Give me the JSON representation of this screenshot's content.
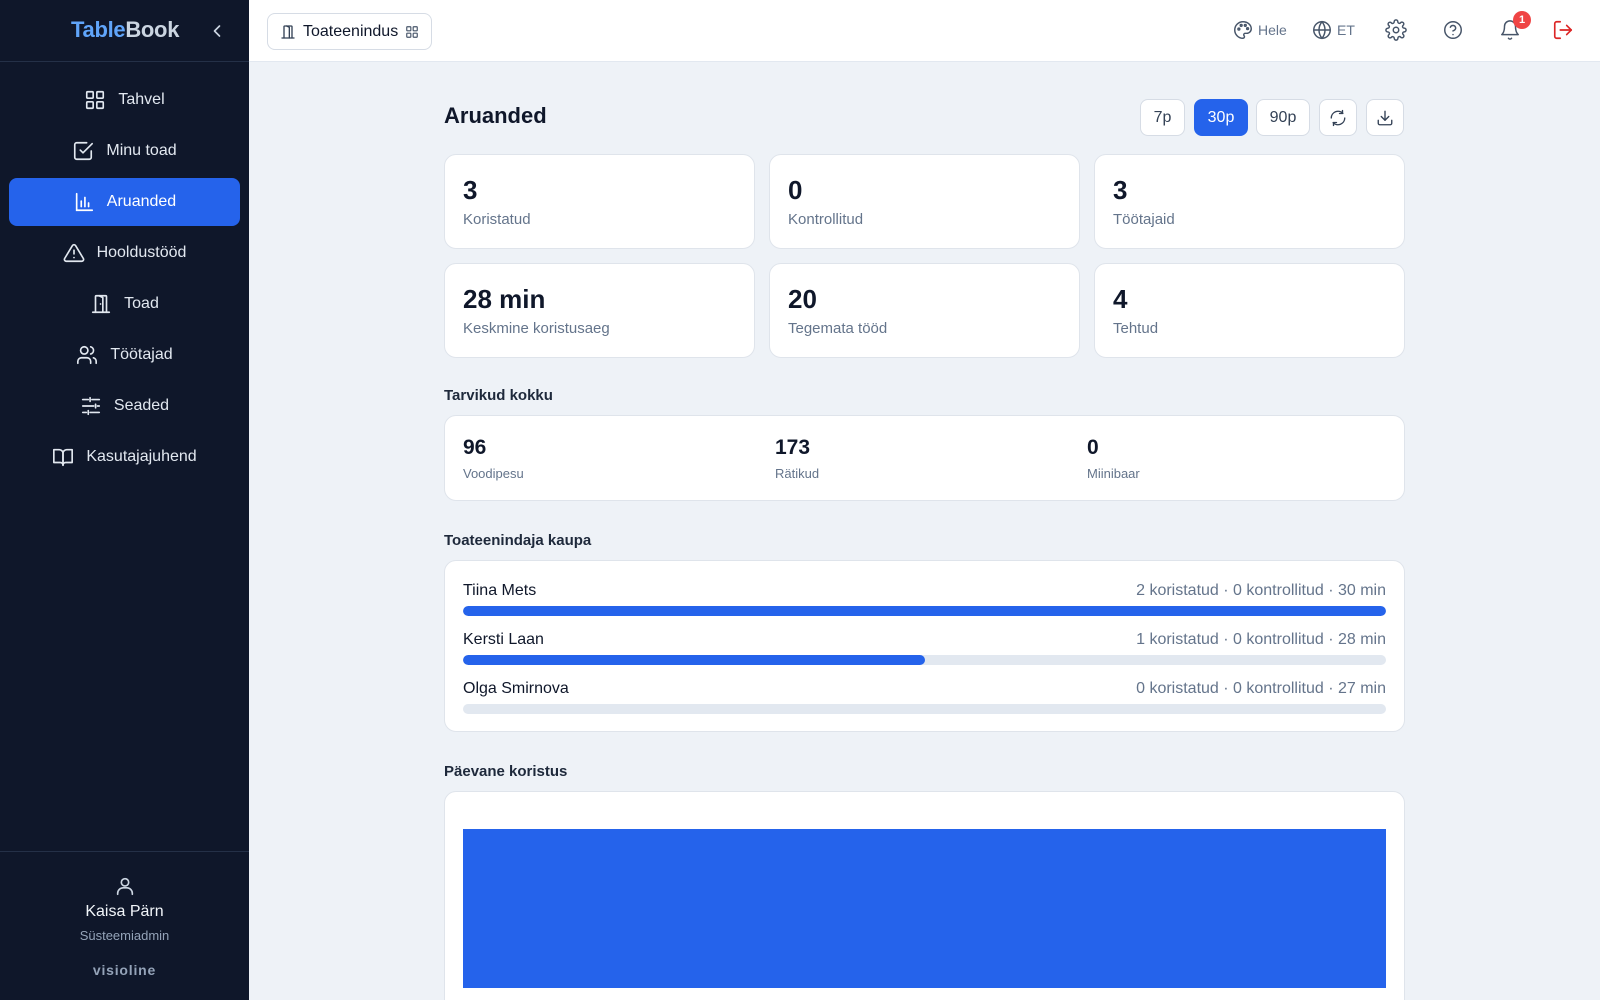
{
  "brand": {
    "part1": "Table",
    "part2": "Book"
  },
  "sidebar": {
    "items": [
      {
        "label": "Tahvel",
        "icon": "grid-icon"
      },
      {
        "label": "Minu toad",
        "icon": "check-square-icon"
      },
      {
        "label": "Aruanded",
        "icon": "bar-chart-icon",
        "active": true
      },
      {
        "label": "Hooldustööd",
        "icon": "warning-triangle-icon"
      },
      {
        "label": "Toad",
        "icon": "door-icon"
      },
      {
        "label": "Töötajad",
        "icon": "users-icon"
      },
      {
        "label": "Seaded",
        "icon": "sliders-icon"
      },
      {
        "label": "Kasutajajuhend",
        "icon": "book-icon"
      }
    ],
    "user": {
      "name": "Kaisa Pärn",
      "role": "Süsteemiadmin"
    },
    "footer_logo": "visioline"
  },
  "topbar": {
    "department": "Toateenindus",
    "theme_label": "Hele",
    "language": "ET",
    "notification_count": "1"
  },
  "page": {
    "title": "Aruanded",
    "ranges": [
      "7p",
      "30p",
      "90p"
    ],
    "active_range": "30p"
  },
  "stats": [
    {
      "value": "3",
      "label": "Koristatud"
    },
    {
      "value": "0",
      "label": "Kontrollitud"
    },
    {
      "value": "3",
      "label": "Töötajaid"
    },
    {
      "value": "28 min",
      "label": "Keskmine koristusaeg"
    },
    {
      "value": "20",
      "label": "Tegemata tööd"
    },
    {
      "value": "4",
      "label": "Tehtud"
    }
  ],
  "supplies": {
    "title": "Tarvikud kokku",
    "items": [
      {
        "value": "96",
        "label": "Voodipesu"
      },
      {
        "value": "173",
        "label": "Rätikud"
      },
      {
        "value": "0",
        "label": "Miinibaar"
      }
    ]
  },
  "workers": {
    "title": "Toateenindaja kaupa",
    "items": [
      {
        "name": "Tiina Mets",
        "stats": "2 koristatud · 0 kontrollitud · 30 min",
        "progress": 1.0
      },
      {
        "name": "Kersti Laan",
        "stats": "1 koristatud · 0 kontrollitud · 28 min",
        "progress": 0.5
      },
      {
        "name": "Olga Smirnova",
        "stats": "0 koristatud · 0 kontrollitud · 27 min",
        "progress": 0.0
      }
    ]
  },
  "daily": {
    "title": "Päevane koristus"
  },
  "colors": {
    "accent": "#2563eb",
    "sidebar_bg": "#0f172a",
    "danger": "#ef4444"
  },
  "chart_data": {
    "type": "bar",
    "categories": [
      ""
    ],
    "values": [
      3
    ],
    "title": "Päevane koristus",
    "xlabel": "",
    "ylabel": ""
  }
}
